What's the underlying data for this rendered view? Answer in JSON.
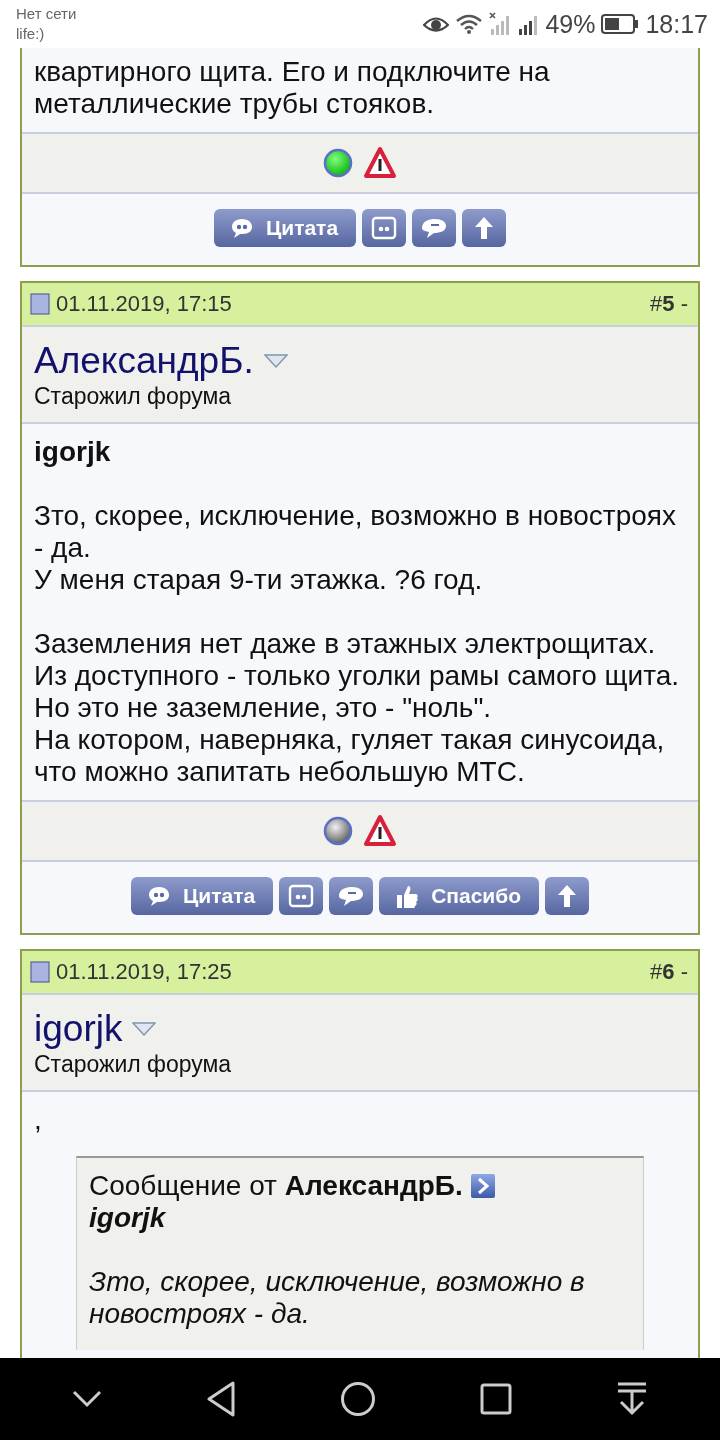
{
  "status_bar": {
    "carrier_line_1": "Нет сети",
    "carrier_line_2": "life:)",
    "battery": "49%",
    "time": "18:17"
  },
  "posts": [
    {
      "body": [
        {
          "kind": "text",
          "lines": [
            "квартирного щита. Его и подключите на",
            "металлические трубы стояков."
          ]
        }
      ],
      "online": true,
      "buttons": [
        {
          "kind": "quote",
          "label": "Цитата"
        },
        {
          "kind": "multiquote"
        },
        {
          "kind": "quick"
        },
        {
          "kind": "top"
        }
      ]
    },
    {
      "date": "01.11.2019, 17:15",
      "number": "#**5** -",
      "user": "АлександрБ.",
      "rank": "Старожил форума",
      "body": [
        {
          "kind": "bold",
          "lines": [
            "igorjk"
          ]
        },
        {
          "kind": "text",
          "lines": [
            "Зто, скорее, исключение, возможно в новостроях - да.",
            "У меня старая 9-ти этажка. ?6 год."
          ]
        },
        {
          "kind": "text",
          "lines": [
            "Заземления нет даже в этажных электрощитах.",
            "Из доступного - только уголки рамы самого щита.",
            "Но это не заземление, это - \"ноль\".",
            "На котором, наверняка, гуляет такая синусоида, что можно запитать небольшую МТС."
          ]
        }
      ],
      "online": false,
      "buttons": [
        {
          "kind": "quote",
          "label": "Цитата"
        },
        {
          "kind": "multiquote"
        },
        {
          "kind": "quick"
        },
        {
          "kind": "thanks",
          "label": "Спасибо"
        },
        {
          "kind": "top"
        }
      ]
    },
    {
      "date": "01.11.2019, 17:25",
      "number": "#**6** -",
      "user": "igorjk",
      "rank": "Старожил форума",
      "body": [
        {
          "kind": "text",
          "lines": [
            ","
          ]
        },
        {
          "kind": "quote",
          "header": "Сообщение от **АлександрБ.**",
          "author": "igorjk",
          "lines": [
            "Зто, скорее, исключение, возможно в новостроях - да."
          ]
        }
      ]
    }
  ]
}
